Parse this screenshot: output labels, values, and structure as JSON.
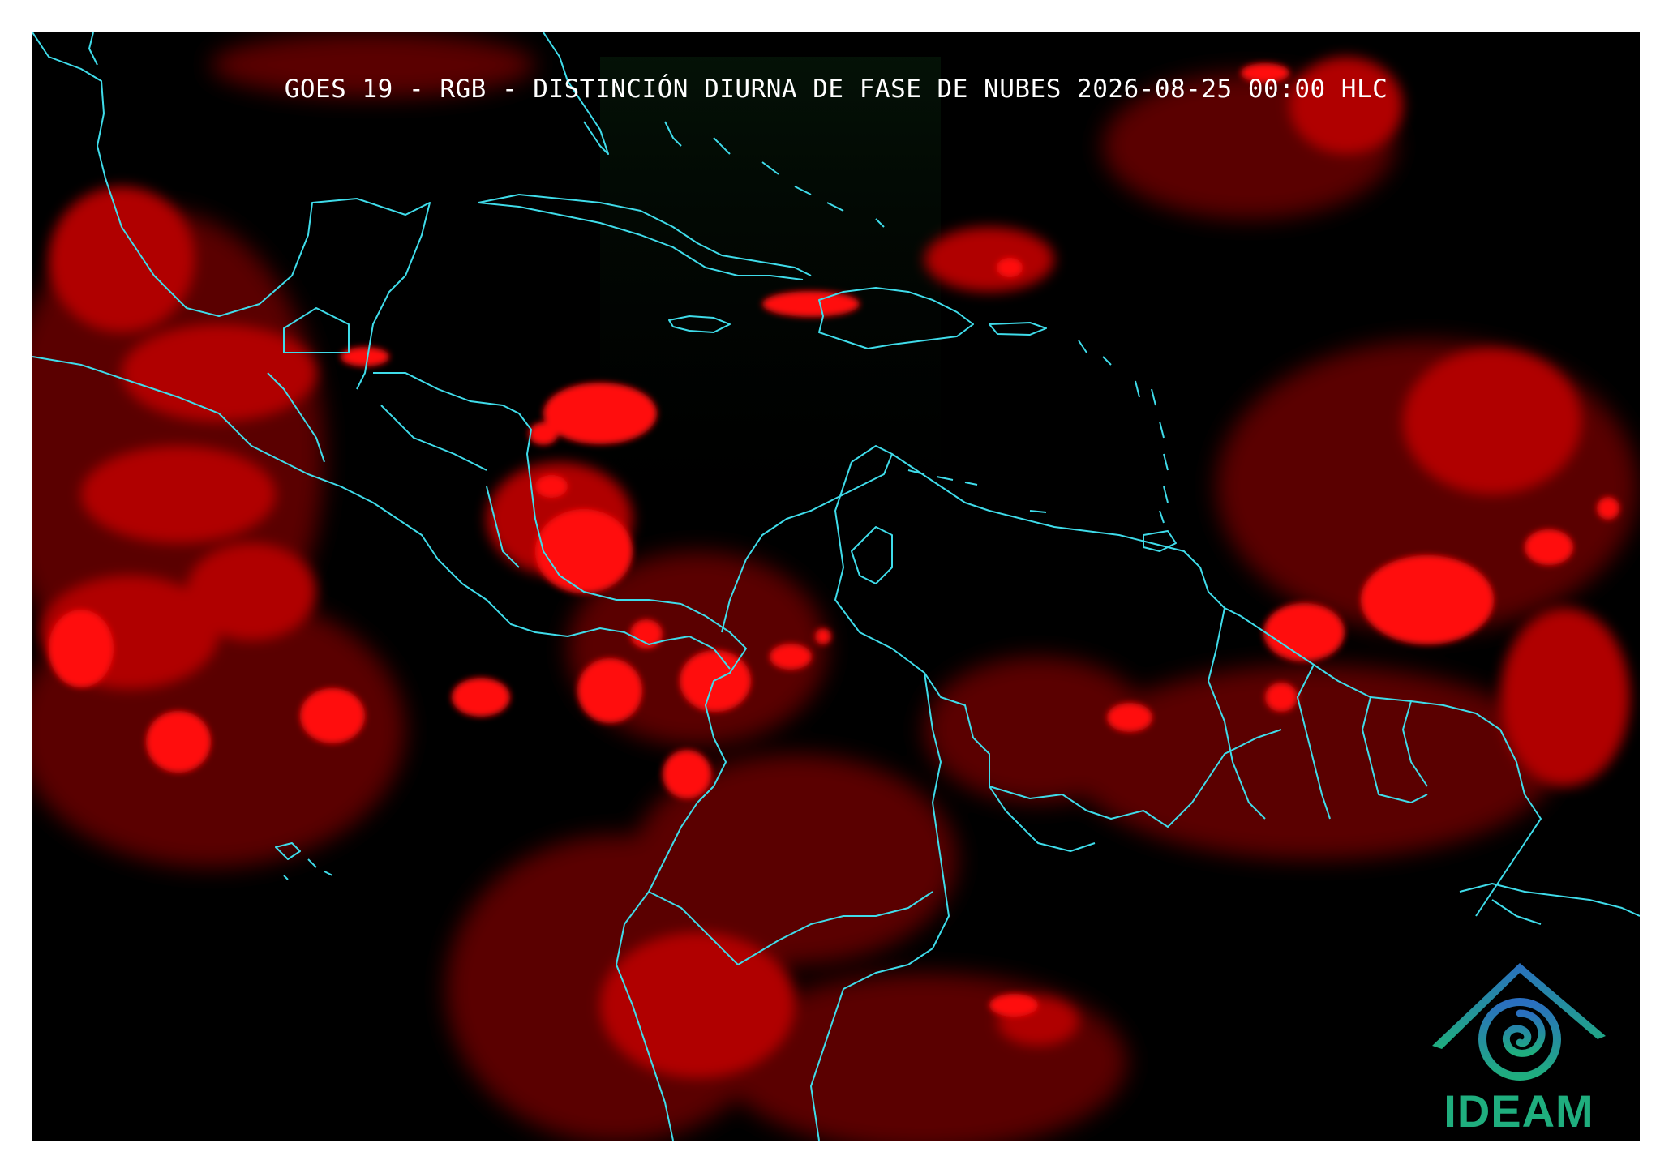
{
  "title": "GOES 19 - RGB - DISTINCIÓN DIURNA DE FASE DE NUBES 2026-08-25 00:00 HLC",
  "logo": {
    "text": "IDEAM",
    "icon": "ideam-mountain-swirl-icon"
  },
  "colors": {
    "background": "#000000",
    "cloud": "#ff0000",
    "coastline": "#3fdcea",
    "logo_green": "#1fae7e",
    "logo_blue": "#2a6fc0"
  }
}
